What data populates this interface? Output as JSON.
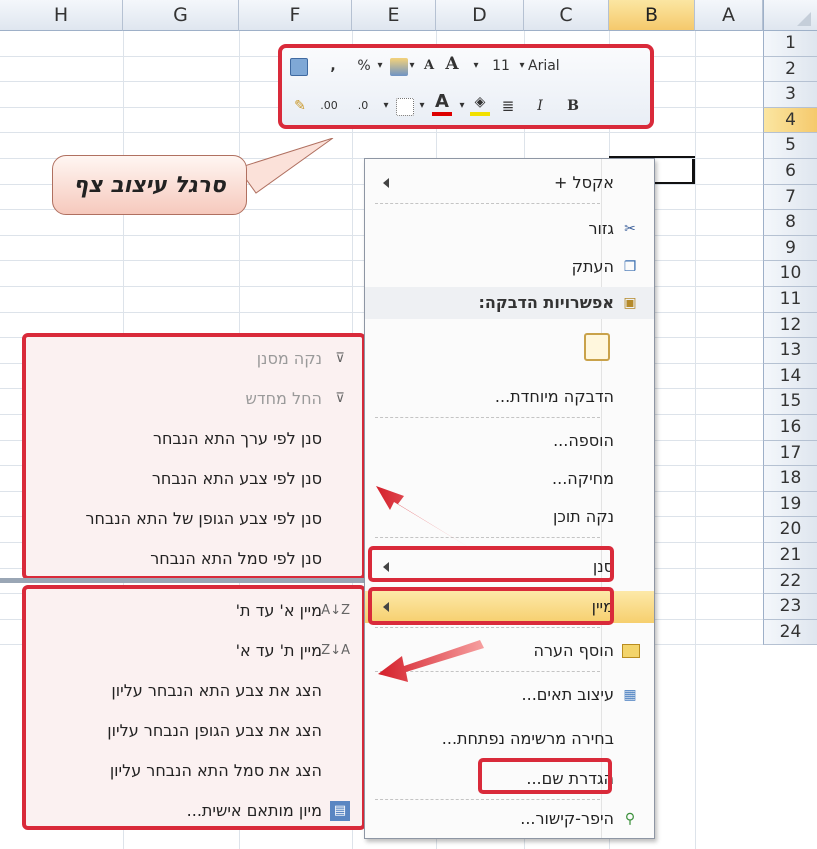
{
  "spreadsheet": {
    "columns": [
      "H",
      "G",
      "F",
      "E",
      "D",
      "C",
      "B",
      "A"
    ],
    "selected_column": "B",
    "rows": [
      "1",
      "2",
      "3",
      "4",
      "5",
      "6",
      "7",
      "8",
      "9",
      "10",
      "11",
      "12",
      "13",
      "14",
      "15",
      "16",
      "17",
      "18",
      "19",
      "20",
      "21",
      "22",
      "23",
      "24"
    ],
    "selected_row": "4"
  },
  "toolbar": {
    "font_name": "Arial",
    "font_size": "11",
    "grow_font": "A",
    "shrink_font": "A",
    "percent": "%",
    "comma": ",",
    "bold": "B",
    "italic": "I",
    "font_color": "A",
    "increase_decimal": ".00",
    "decrease_decimal": ".0"
  },
  "callout": {
    "label": "סרגל עיצוב צף"
  },
  "context_menu": {
    "items": [
      {
        "label": "אקסל +",
        "icon": "submenu-arrow"
      },
      {
        "label": "גזור",
        "icon": "scissors-icon"
      },
      {
        "label": "העתק",
        "icon": "copy-icon"
      },
      {
        "label": "אפשרויות הדבקה:",
        "icon": "paste-icon"
      },
      {
        "label": "",
        "icon": "clipboard-icon"
      },
      {
        "label": "הדבקה מיוחדת...",
        "icon": ""
      },
      {
        "label": "הוספה...",
        "icon": ""
      },
      {
        "label": "מחיקה...",
        "icon": ""
      },
      {
        "label": "נקה תוכן",
        "icon": ""
      },
      {
        "label": "סנן",
        "icon": "submenu-arrow"
      },
      {
        "label": "מיין",
        "icon": "submenu-arrow"
      },
      {
        "label": "הוסף הערה",
        "icon": "comment-icon"
      },
      {
        "label": "עיצוב תאים...",
        "icon": "format-cells-icon"
      },
      {
        "label": "בחירה מרשימה נפתחת...",
        "icon": ""
      },
      {
        "label": "הגדרת שם...",
        "icon": ""
      },
      {
        "label": "היפר-קישור...",
        "icon": "hyperlink-icon"
      }
    ]
  },
  "filter_submenu": {
    "items": [
      {
        "label": "נקה מסנן",
        "disabled": true
      },
      {
        "label": "החל מחדש",
        "disabled": true
      },
      {
        "label": "סנן לפי ערך התא הנבחר",
        "disabled": false
      },
      {
        "label": "סנן לפי צבע התא הנבחר",
        "disabled": false
      },
      {
        "label": "סנן לפי צבע הגופן של התא הנבחר",
        "disabled": false
      },
      {
        "label": "סנן לפי סמל התא הנבחר",
        "disabled": false
      }
    ]
  },
  "sort_submenu": {
    "items": [
      {
        "label": "מיין א' עד ת'",
        "icon": "A↓Z"
      },
      {
        "label": "מיין ת' עד א'",
        "icon": "Z↓A"
      },
      {
        "label": "הצג את צבע התא הנבחר עליון",
        "icon": ""
      },
      {
        "label": "הצג את צבע הגופן הנבחר עליון",
        "icon": ""
      },
      {
        "label": "הצג את סמל התא הנבחר עליון",
        "icon": ""
      },
      {
        "label": "מיון מותאם אישית...",
        "icon": "custom-sort-icon"
      }
    ]
  },
  "colors": {
    "accent_red": "#d92a3a",
    "selection": "#f6cf6e"
  }
}
